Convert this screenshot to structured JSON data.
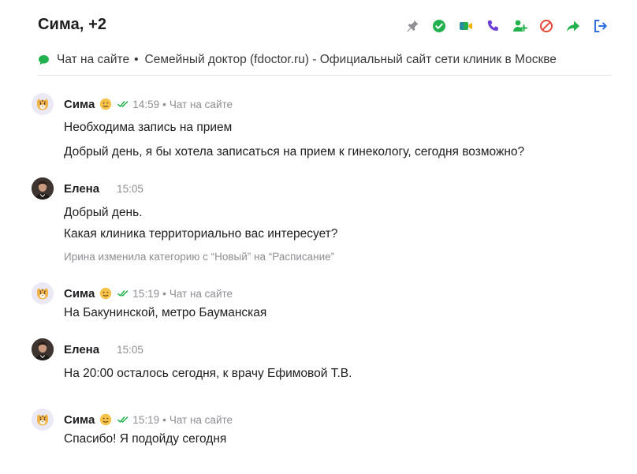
{
  "header": {
    "title": "Сима, +2",
    "actions": [
      {
        "name": "pin-icon",
        "label": "Закрепить",
        "color": "#8e8e93"
      },
      {
        "name": "check-circle-icon",
        "label": "Завершить",
        "color": "#22b14c"
      },
      {
        "name": "video-call-icon",
        "label": "Видеозвонок",
        "color": "#22b14c"
      },
      {
        "name": "phone-icon",
        "label": "Позвонить",
        "color": "#6e3fd6"
      },
      {
        "name": "add-user-icon",
        "label": "Добавить участника",
        "color": "#22b14c"
      },
      {
        "name": "block-icon",
        "label": "Заблокировать",
        "color": "#e5473a"
      },
      {
        "name": "forward-icon",
        "label": "Переслать",
        "color": "#22b14c"
      },
      {
        "name": "exit-icon",
        "label": "Выйти",
        "color": "#2f6fe0"
      }
    ]
  },
  "source": {
    "channel": "Чат на сайте",
    "separator": "•",
    "site": "Семейный доктор (fdoctor.ru) - Официальный сайт сети клиник в Москве"
  },
  "messages": [
    {
      "author": "Сима",
      "time": "14:59",
      "channel": "Чат на сайте",
      "lines": [
        "Необходима запись на прием",
        "Добрый день, я бы хотела записаться на прием к гинекологу, сегодня возможно?"
      ]
    },
    {
      "author": "Елена",
      "time": "15:05",
      "lines": [
        "Добрый день.",
        "Какая клиника территориально вас интересует?"
      ],
      "system": "Ирина изменила категорию с “Новый” на “Расписание”"
    },
    {
      "author": "Сима",
      "time": "15:19",
      "channel": "Чат на сайте",
      "lines": [
        "На Бакунинской, метро Бауманская"
      ]
    },
    {
      "author": "Елена",
      "time": "15:05",
      "lines": [
        "На 20:00 осталось сегодня, к врачу Ефимовой Т.В."
      ]
    },
    {
      "author": "Сима",
      "time": "15:19",
      "channel": "Чат на сайте",
      "lines": [
        "Спасибо! Я подойду сегодня"
      ]
    }
  ],
  "bullet": "•"
}
